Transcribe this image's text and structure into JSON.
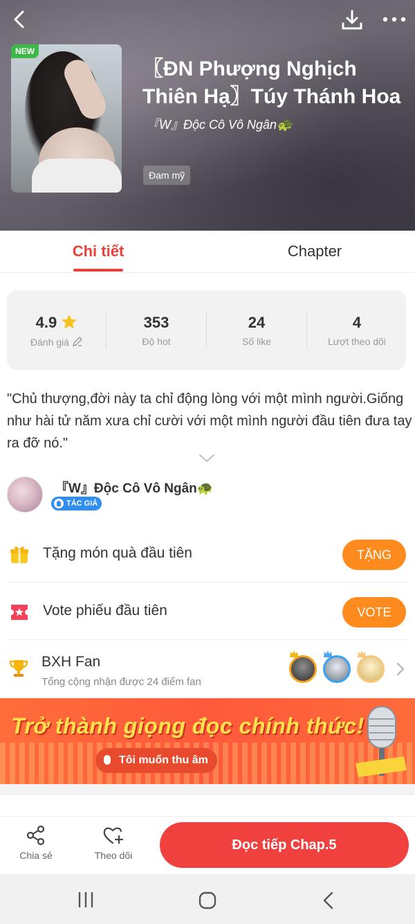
{
  "header": {
    "back_icon": "chevron-left-icon",
    "download_icon": "download-icon",
    "more_icon": "more-horizontal-icon",
    "badge": "NEW",
    "title_line1": "〖ĐN Phượng Nghịch",
    "title_line2": "Thiên Hạ〗Túy Thánh Hoa",
    "author": "『W』Độc Cô Vô Ngân🐢",
    "genre_tag": "Đam mỹ"
  },
  "tabs": [
    {
      "label": "Chi tiết",
      "active": true
    },
    {
      "label": "Chapter",
      "active": false
    }
  ],
  "stats": [
    {
      "value": "4.9",
      "label": "Đánh giá",
      "icon": "star-icon",
      "label_icon": "edit-icon"
    },
    {
      "value": "353",
      "label": "Độ hot"
    },
    {
      "value": "24",
      "label": "Số like"
    },
    {
      "value": "4",
      "label": "Lượt theo dõi"
    }
  ],
  "description": "\"Chủ thượng,đời này ta chỉ động lòng với một mình người.Giống như hài tử năm xưa chỉ cười với một mình người đầu tiên đưa tay ra đỡ nó.\"",
  "author_section": {
    "name": "『W』Độc Cô Vô Ngân🐢",
    "badge": "TÁC GIẢ"
  },
  "actions": [
    {
      "label": "Tặng món quà đầu tiên",
      "button": "TẶNG",
      "icon": "gift-icon"
    },
    {
      "label": "Vote phiếu đầu tiên",
      "button": "VOTE",
      "icon": "ticket-icon"
    }
  ],
  "fan_ranking": {
    "title": "BXH Fan",
    "subtitle": "Tổng cộng nhận được 24 điểm fan",
    "icon": "trophy-icon"
  },
  "banner": {
    "headline": "Trở thành giọng đọc chính thức!",
    "button": "Tôi muốn thu âm"
  },
  "bottom_bar": {
    "share": "Chia sẻ",
    "follow": "Theo dõi",
    "read": "Đọc tiếp Chap.5"
  },
  "colors": {
    "accent": "#e8413c",
    "orange": "#ff8a1d",
    "read_button": "#f1413f"
  }
}
